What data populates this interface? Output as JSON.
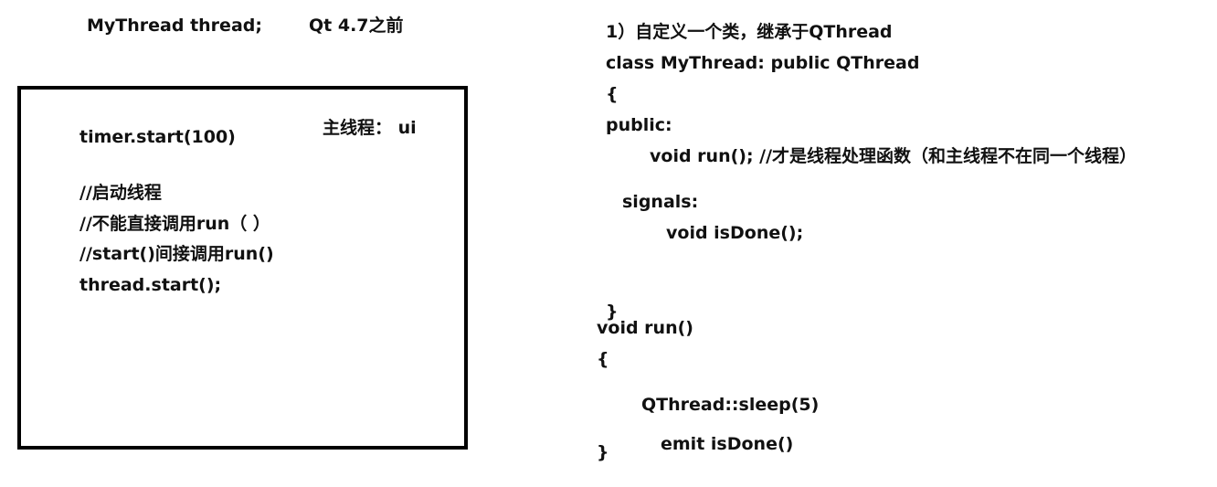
{
  "header": {
    "thread_decl": "MyThread thread;",
    "qt_version_note": "Qt 4.7之前"
  },
  "main_box": {
    "label": "主线程： ui",
    "lines": [
      "timer.start(100)",
      "//启动线程",
      "//不能直接调用run（ ）",
      "//start()间接调用run()",
      "thread.start();"
    ]
  },
  "class_def": {
    "step": "1）自定义一个类，继承于QThread",
    "decl": "class MyThread: public QThread",
    "open_brace": "{",
    "public_kw": "public:",
    "run_decl": "void run(); //才是线程处理函数（和主线程不在同一个线程）",
    "signals_kw": "signals:",
    "signal_decl": "void isDone();",
    "close_brace": "}"
  },
  "run_impl": {
    "signature": "void run()",
    "open_brace": "{",
    "sleep_call": "QThread::sleep(5)",
    "emit_call": "emit isDone()",
    "close_brace": "}"
  }
}
